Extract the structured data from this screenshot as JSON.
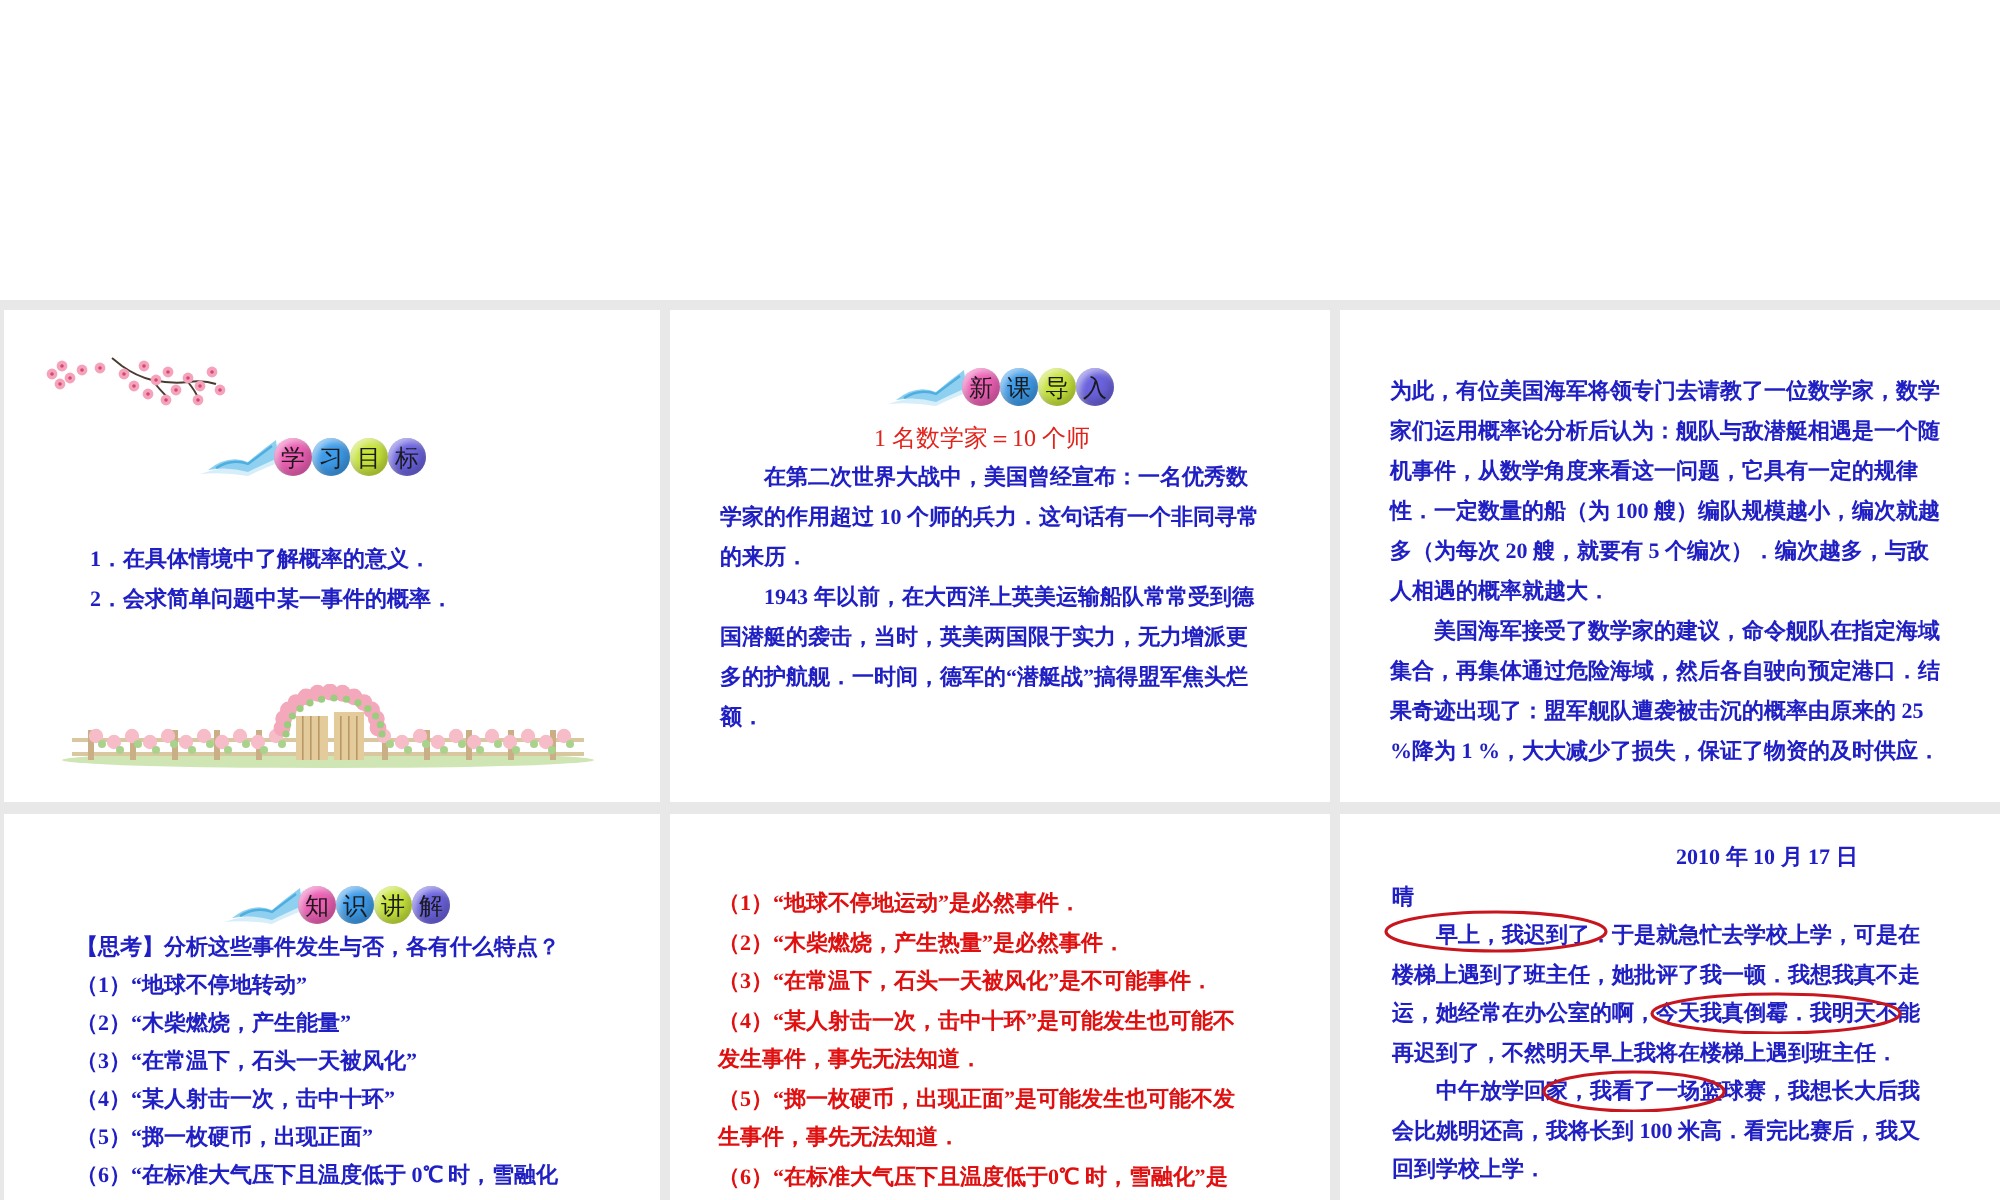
{
  "slides": [
    {
      "kind": "objectives",
      "banner": [
        {
          "char": "学",
          "color": "#ec5fb4"
        },
        {
          "char": "习",
          "color": "#3d9be9"
        },
        {
          "char": "目",
          "color": "#c6e33a"
        },
        {
          "char": "标",
          "color": "#6b62dd"
        }
      ],
      "items": [
        "1．在具体情境中了解概率的意义．",
        "2．会求简单问题中某一事件的概率．"
      ]
    },
    {
      "kind": "story",
      "banner": [
        {
          "char": "新",
          "color": "#ec5fb4"
        },
        {
          "char": "课",
          "color": "#3d9be9"
        },
        {
          "char": "导",
          "color": "#c6e33a"
        },
        {
          "char": "入",
          "color": "#6b62dd"
        }
      ],
      "heading": "1 名数学家＝10 个师",
      "paragraphs": [
        {
          "text": "在第二次世界大战中，美国曾经宣布：一名优秀数学家的作用超过 10 个师的兵力．这句话有一个非同寻常的来历．",
          "indent": true
        },
        {
          "text": "1943 年以前，在大西洋上英美运输船队常常受到德国潜艇的袭击，当时，英美两国限于实力，无力增派更多的护航舰．一时间，德军的“潜艇战”搞得盟军焦头烂额．",
          "indent": true
        }
      ]
    },
    {
      "kind": "story",
      "paragraphs": [
        {
          "text": "为此，有位美国海军将领专门去请教了一位数学家，数学家们运用概率论分析后认为：舰队与敌潜艇相遇是一个随机事件，从数学角度来看这一问题，它具有一定的规律性．一定数量的船（为 100 艘）编队规模越小，编次就越多（为每次 20 艘，就要有 5 个编次）．编次越多，与敌人相遇的概率就越大．",
          "indent": false
        },
        {
          "text": "美国海军接受了数学家的建议，命令舰队在指定海域集合，再集体通过危险海域，然后各自驶向预定港口．结果奇迹出现了：盟军舰队遭袭被击沉的概率由原来的 25 %降为 1 %，大大减少了损失，保证了物资的及时供应．",
          "indent": true
        }
      ]
    },
    {
      "kind": "questions",
      "banner": [
        {
          "char": "知",
          "color": "#ec5fb4"
        },
        {
          "char": "识",
          "color": "#3d9be9"
        },
        {
          "char": "讲",
          "color": "#c6e33a"
        },
        {
          "char": "解",
          "color": "#6b62dd"
        }
      ],
      "prompt": "【思考】分析这些事件发生与否，各有什么特点？",
      "items": [
        "（1）“地球不停地转动”",
        "（2）“木柴燃烧，产生能量”",
        "（3）“在常温下，石头一天被风化”",
        "（4）“某人射击一次，击中十环”",
        "（5）“掷一枚硬币，出现正面”",
        "（6）“在标准大气压下且温度低于 0℃ 时，雪融化"
      ]
    },
    {
      "kind": "answers",
      "items": [
        "（1）“地球不停地运动”是必然事件．",
        "（2）“木柴燃烧，产生热量”是必然事件．",
        "（3）“在常温下，石头一天被风化”是不可能事件．",
        "（4）“某人射击一次，击中十环”是可能发生也可能不发生事件，事先无法知道．",
        "（5）“掷一枚硬币，出现正面”是可能发生也可能不发生事件，事先无法知道．",
        "（6）“在标准大气压下且温度低于0℃ 时，雪融化”是"
      ]
    },
    {
      "kind": "diary",
      "date": "2010 年 10 月 17 日",
      "weather": "晴",
      "paragraphs": [
        {
          "text": "早上，我迟到了．于是就急忙去学校上学，可是在楼梯上遇到了班主任，她批评了我一顿．我想我真不走运，她经常在办公室的啊，今天我真倒霉．我明天不能再迟到了，不然明天早上我将在楼梯上遇到班主任．",
          "indent": true
        },
        {
          "text": "中午放学回家，我看了一场篮球赛，我想长大后我会比姚明还高，我将长到 100 米高．看完比赛后，我又回到学校上学．",
          "indent": true
        }
      ]
    }
  ]
}
